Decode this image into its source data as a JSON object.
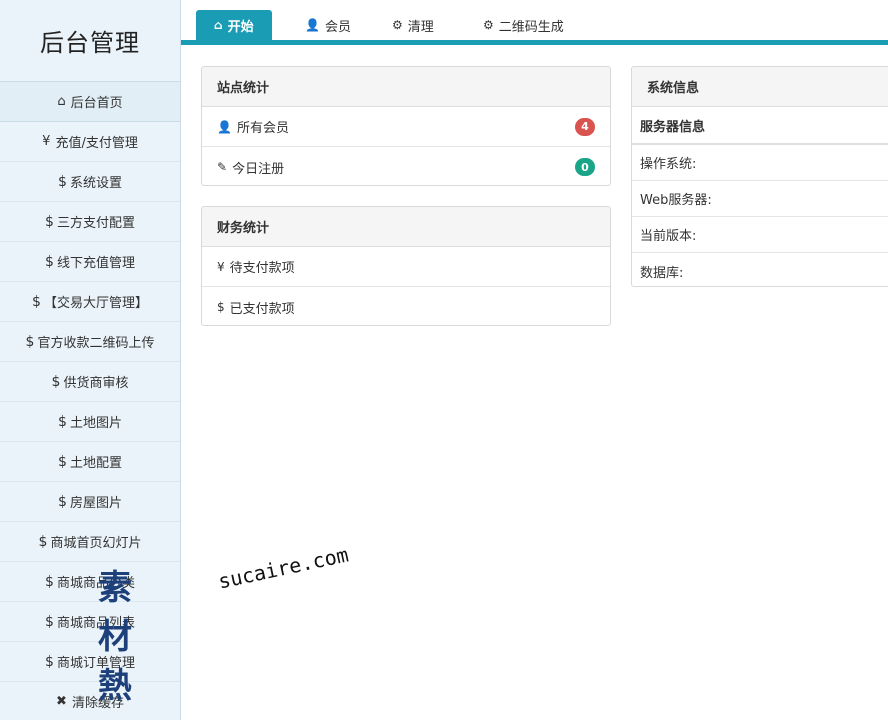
{
  "app": {
    "title": "后台管理"
  },
  "sidebar": {
    "items": [
      {
        "icon": "home-icon",
        "glyph": "⌂",
        "label": "后台首页"
      },
      {
        "icon": "yen-icon",
        "glyph": "¥",
        "label": "充值/支付管理"
      },
      {
        "icon": "dollar-icon",
        "glyph": "$",
        "label": "系统设置"
      },
      {
        "icon": "dollar-icon",
        "glyph": "$",
        "label": "三方支付配置"
      },
      {
        "icon": "dollar-icon",
        "glyph": "$",
        "label": "线下充值管理"
      },
      {
        "icon": "dollar-icon",
        "glyph": "$",
        "label": "【交易大厅管理】"
      },
      {
        "icon": "dollar-icon",
        "glyph": "$",
        "label": "官方收款二维码上传"
      },
      {
        "icon": "dollar-icon",
        "glyph": "$",
        "label": "供货商审核"
      },
      {
        "icon": "dollar-icon",
        "glyph": "$",
        "label": "土地图片"
      },
      {
        "icon": "dollar-icon",
        "glyph": "$",
        "label": "土地配置"
      },
      {
        "icon": "dollar-icon",
        "glyph": "$",
        "label": "房屋图片"
      },
      {
        "icon": "dollar-icon",
        "glyph": "$",
        "label": "商城首页幻灯片"
      },
      {
        "icon": "dollar-icon",
        "glyph": "$",
        "label": "商城商品分类"
      },
      {
        "icon": "dollar-icon",
        "glyph": "$",
        "label": "商城商品列表"
      },
      {
        "icon": "dollar-icon",
        "glyph": "$",
        "label": "商城订单管理"
      },
      {
        "icon": "close-icon",
        "glyph": "✖",
        "label": "清除缓存"
      }
    ]
  },
  "tabs": [
    {
      "label": "开始",
      "glyph": "⌂"
    },
    {
      "label": "会员",
      "glyph": "👤"
    },
    {
      "label": "清理",
      "glyph": "⚙"
    },
    {
      "label": "二维码生成",
      "glyph": "⚙"
    }
  ],
  "site_stats": {
    "title": "站点统计",
    "rows": [
      {
        "label": "所有会员",
        "glyph": "👤",
        "count": "4"
      },
      {
        "label": "今日注册",
        "glyph": "✎",
        "count": "0"
      }
    ]
  },
  "finance_stats": {
    "title": "财务统计",
    "rows": [
      {
        "label": "待支付款项",
        "glyph": "¥"
      },
      {
        "label": "已支付款项",
        "glyph": "$"
      }
    ]
  },
  "system_info": {
    "title": "系统信息",
    "subtitle": "服务器信息",
    "rows": [
      {
        "label": "操作系统:"
      },
      {
        "label": "Web服务器:"
      },
      {
        "label": "当前版本:"
      },
      {
        "label": "数据库:"
      }
    ]
  },
  "watermark": {
    "cn": "素材熱",
    "en": "sucaire.com"
  },
  "colors": {
    "accent": "#1a9cb5",
    "badge_red": "#d9534f",
    "badge_teal": "#1aa589",
    "sidebar_bg": "#eaf3f9"
  }
}
